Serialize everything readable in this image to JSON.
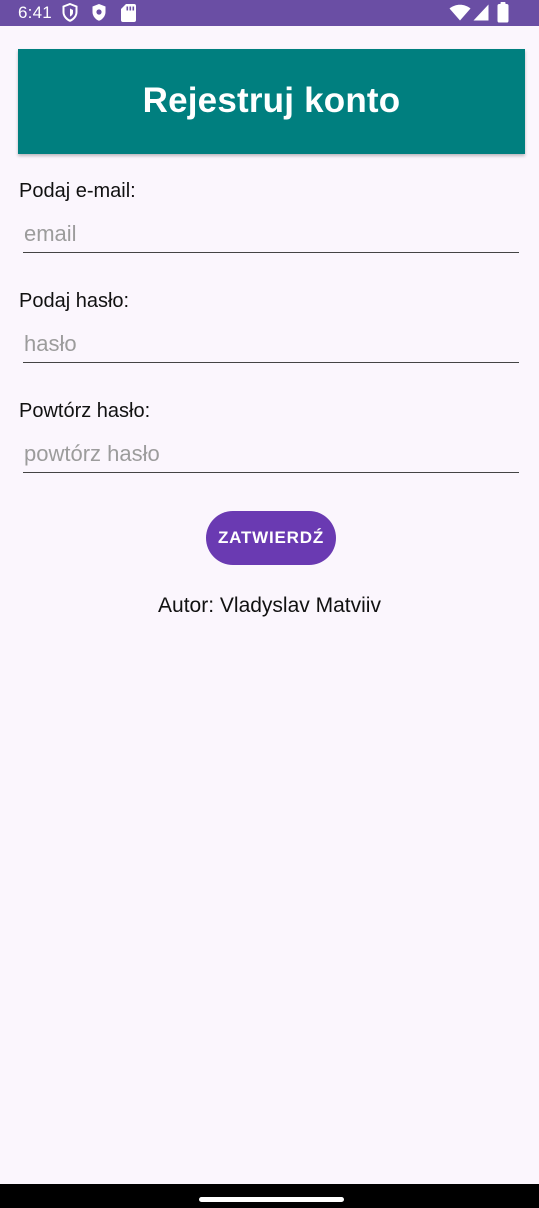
{
  "status_bar": {
    "time": "6:41",
    "left_icons": [
      "shield-outline-icon",
      "shield-filled-icon",
      "sd-card-icon"
    ],
    "right_icons": [
      "wifi-icon",
      "cellular-signal-icon",
      "battery-icon"
    ],
    "background": "#6a4ea4"
  },
  "header": {
    "title": "Rejestruj konto",
    "background": "#007f7f"
  },
  "form": {
    "email": {
      "label": "Podaj e-mail:",
      "placeholder": "email",
      "value": ""
    },
    "password": {
      "label": "Podaj hasło:",
      "placeholder": "hasło",
      "value": ""
    },
    "repeat_password": {
      "label": "Powtórz hasło:",
      "placeholder": "powtórz hasło",
      "value": ""
    },
    "submit_label": "ZATWIERDŹ",
    "submit_color": "#6a3ab2"
  },
  "footer": {
    "author": "Autor: Vladyslav Matviiv"
  }
}
